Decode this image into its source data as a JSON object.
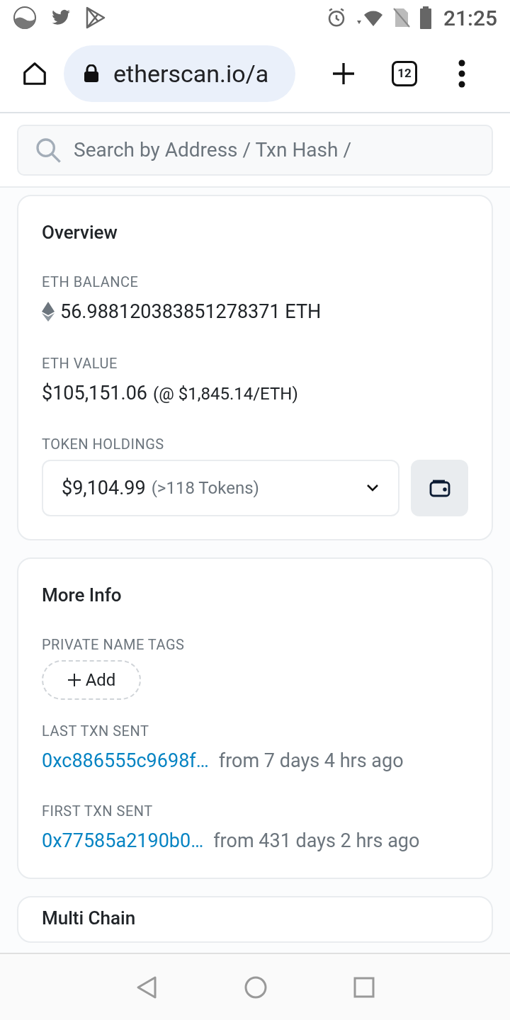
{
  "status_bar": {
    "time": "21:25"
  },
  "browser": {
    "url": "etherscan.io/a",
    "tab_count": "12"
  },
  "search": {
    "placeholder": "Search by Address / Txn Hash /"
  },
  "overview": {
    "title": "Overview",
    "eth_balance": {
      "label": "ETH BALANCE",
      "value": "56.988120383851278371 ETH"
    },
    "eth_value": {
      "label": "ETH VALUE",
      "value": "$105,151.06",
      "rate": "(@ $1,845.14/ETH)"
    },
    "token_holdings": {
      "label": "TOKEN HOLDINGS",
      "value": "$9,104.99",
      "count": "(>118 Tokens)"
    }
  },
  "more_info": {
    "title": "More Info",
    "private_name_tags": {
      "label": "PRIVATE NAME TAGS",
      "button": "Add"
    },
    "transactions": [
      {
        "label": "LAST TXN SENT",
        "hash": "0xc886555c9698f…",
        "age": "from 7 days 4 hrs ago"
      },
      {
        "label": "FIRST TXN SENT",
        "hash": "0x77585a2190b0…",
        "age": "from 431 days 2 hrs ago"
      }
    ]
  },
  "next_card": {
    "title": "Multi Chain"
  }
}
